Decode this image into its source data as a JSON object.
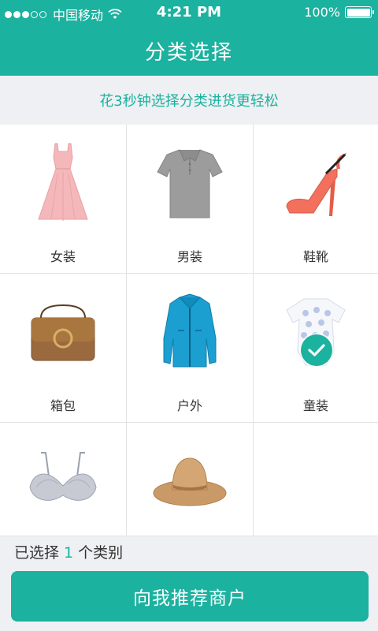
{
  "status_bar": {
    "carrier": "中国移动",
    "time": "4:21 PM",
    "battery": "100%"
  },
  "header": {
    "title": "分类选择"
  },
  "banner": {
    "text": "花3秒钟选择分类进货更轻松"
  },
  "categories": [
    {
      "label": "女装",
      "icon": "dress-icon",
      "selected": false
    },
    {
      "label": "男装",
      "icon": "polo-shirt-icon",
      "selected": false
    },
    {
      "label": "鞋靴",
      "icon": "high-heel-shoe-icon",
      "selected": false
    },
    {
      "label": "箱包",
      "icon": "handbag-icon",
      "selected": false
    },
    {
      "label": "户外",
      "icon": "outdoor-jacket-icon",
      "selected": false
    },
    {
      "label": "童装",
      "icon": "baby-romper-icon",
      "selected": true
    },
    {
      "label": "",
      "icon": "bra-icon",
      "selected": false
    },
    {
      "label": "",
      "icon": "sun-hat-icon",
      "selected": false
    }
  ],
  "footer": {
    "summary_prefix": "已选择",
    "selected_count": "1",
    "summary_suffix": "个类别",
    "button_label": "向我推荐商户"
  },
  "colors": {
    "accent": "#1bb29f",
    "background_light": "#eef0f3"
  }
}
